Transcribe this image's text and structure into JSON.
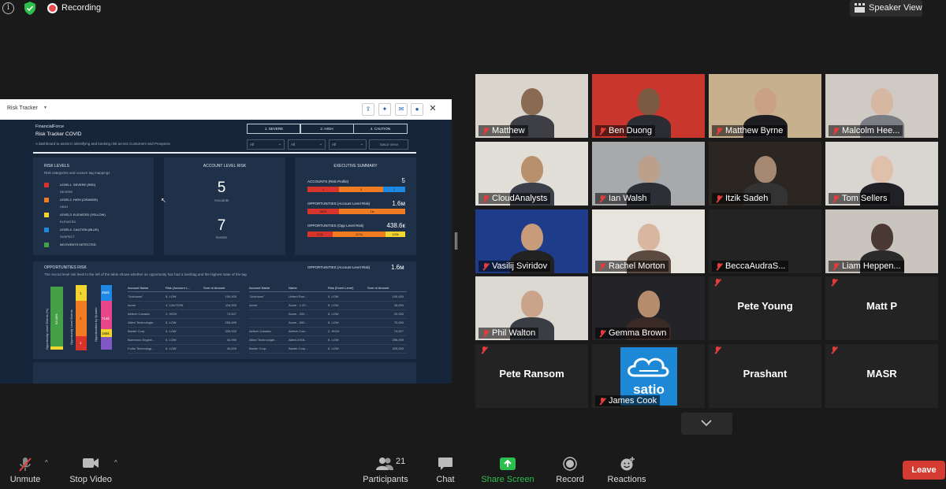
{
  "topbar": {
    "recording_label": "Recording",
    "speaker_view_label": "Speaker View"
  },
  "share": {
    "header_title": "Risk Tracker",
    "org": "FinancialForce",
    "title": "Risk Tracker COVID",
    "subtitle": "A dashboard to assist in identifying and tracking risk across Customers and Prospects",
    "buttons": [
      "1. SEVERE",
      "2. HIGH",
      "4. CAUTION"
    ],
    "filters": [
      "All",
      "All",
      "All"
    ],
    "table_view_label": "TABLE VIEW",
    "risk_levels": {
      "title": "RISK LEVELS",
      "subtitle": "Risk categories and custom tag mappings",
      "items": [
        {
          "label": "LEVEL1. SEVERE (RED)",
          "sub": "SEVERE",
          "color": "#d9342b"
        },
        {
          "label": "LEVEL2. HIGH (ORANGE)",
          "sub": "HIGH",
          "color": "#f07b20"
        },
        {
          "label": "LEVEL3. ELEVATED (YELLOW)",
          "sub": "ELEVATED",
          "color": "#f2d42f"
        },
        {
          "label": "LEVEL4. CAUTION (BLUE)",
          "sub": "SUSPECT",
          "color": "#1e88e5"
        },
        {
          "label": "NO EVENTS DETECTED",
          "sub": "",
          "color": "#43a047"
        }
      ]
    },
    "account_level_risk": {
      "title": "ACCOUNT LEVEL RISK",
      "accounts_value": "5",
      "accounts_label": "Accounts",
      "events_value": "7",
      "events_label": "Events"
    },
    "executive_summary": {
      "title": "EXECUTIVE SUMMARY",
      "rows": [
        {
          "label": "ACCOUNTS (Risk Profile)",
          "value": "5",
          "segments": [
            "1",
            "3",
            "1"
          ]
        },
        {
          "label": "OPPORTUNITIES (Account Level Risk)",
          "value": "1.6м",
          "segments": [
            "462k",
            "1м"
          ]
        },
        {
          "label": "OPPORTUNITIES (Opp Level Risk)",
          "value": "438.6к",
          "segments": [
            "112k",
            "227k",
            "100k"
          ]
        }
      ]
    },
    "opps_risk": {
      "title": "OPPORTUNITIES RISK",
      "subtitle": "The record level risk level to the left of the table shows whether an opportunity has had a hashtag and the highest state of the tag",
      "right_label": "OPPORTUNITIES (Account Level Risk)",
      "right_value": "1.6м",
      "vlabels": [
        "Opportunity Level Events (%)",
        "Opportunity Level Events",
        "Opportunities by Quarter"
      ],
      "bar_values": [
        "93.08%",
        "1",
        "2",
        "1",
        "494k",
        "714k",
        "186k"
      ],
      "table1": {
        "headers": [
          "Account Name",
          "Risk (Account L...",
          "Sum of Amount"
        ],
        "rows": [
          [
            "\"Unknown\"",
            "5. LOW",
            "100,000"
          ],
          [
            "Acme",
            "4. CAUTION",
            "116,000"
          ],
          [
            "Airtech Canada",
            "2. HIGH",
            "74,627"
          ],
          [
            "Allied Technologie...",
            "5. LOW",
            "256,499"
          ],
          [
            "Baxter Corp.",
            "5. LOW",
            "325,000"
          ],
          [
            "Barremco Engine...",
            "5. LOW",
            "44,990"
          ],
          [
            "Fortis Technologi...",
            "5. LOW",
            "40,625"
          ]
        ]
      },
      "table2": {
        "headers": [
          "Account Name",
          "Name",
          "Risk (Event Level)",
          "Sum of Amount"
        ],
        "rows": [
          [
            "\"Unknown\"",
            "United Part...",
            "5. LOW",
            "100,000"
          ],
          [
            "Acme",
            "Acme - 1,20...",
            "5. LOW",
            "26,000"
          ],
          [
            "",
            "Acme - 200 ...",
            "5. LOW",
            "20,000"
          ],
          [
            "",
            "Acme - 600 ...",
            "5. LOW",
            "70,000"
          ],
          [
            "Airtech Canada",
            "Airtech Can...",
            "2. HIGH",
            "74,627"
          ],
          [
            "Allied Technologie...",
            "Allied-2018...",
            "5. LOW",
            "256,499"
          ],
          [
            "Baxter Corp.",
            "Baxter Corp...",
            "5. LOW",
            "325,000"
          ]
        ]
      }
    }
  },
  "participants": [
    {
      "name": "Matthew",
      "type": "photo"
    },
    {
      "name": "Ben Duong",
      "type": "photo"
    },
    {
      "name": "Matthew Byrne",
      "type": "photo",
      "active": true
    },
    {
      "name": "Malcolm Hee...",
      "type": "photo"
    },
    {
      "name": "CloudAnalysts",
      "type": "photo"
    },
    {
      "name": "Ian Walsh",
      "type": "photo"
    },
    {
      "name": "Itzik Sadeh",
      "type": "photo"
    },
    {
      "name": "Tom Sellers",
      "type": "photo"
    },
    {
      "name": "Vasilij Sviridov",
      "type": "photo"
    },
    {
      "name": "Rachel Morton",
      "type": "photo"
    },
    {
      "name": "BeccaAudraS...",
      "type": "dark"
    },
    {
      "name": "Liam Heppen...",
      "type": "photo"
    },
    {
      "name": "Phil Walton",
      "type": "photo"
    },
    {
      "name": "Gemma Brown",
      "type": "photo"
    },
    {
      "name": "Pete Young",
      "type": "text"
    },
    {
      "name": "Matt P",
      "type": "text"
    },
    {
      "name": "Pete Ransom",
      "type": "text"
    },
    {
      "name": "James Cook",
      "type": "logo",
      "logo_text": "satio"
    },
    {
      "name": "Prashant",
      "type": "text"
    },
    {
      "name": "MASR",
      "type": "text"
    }
  ],
  "toolbar": {
    "unmute": "Unmute",
    "stop_video": "Stop Video",
    "participants": "Participants",
    "participants_count": "21",
    "chat": "Chat",
    "share_screen": "Share Screen",
    "record": "Record",
    "reactions": "Reactions",
    "leave": "Leave"
  },
  "colors": {
    "share_green": "#2dbf4e",
    "leave_red": "#d43b32",
    "active_outline": "#d8e066"
  }
}
